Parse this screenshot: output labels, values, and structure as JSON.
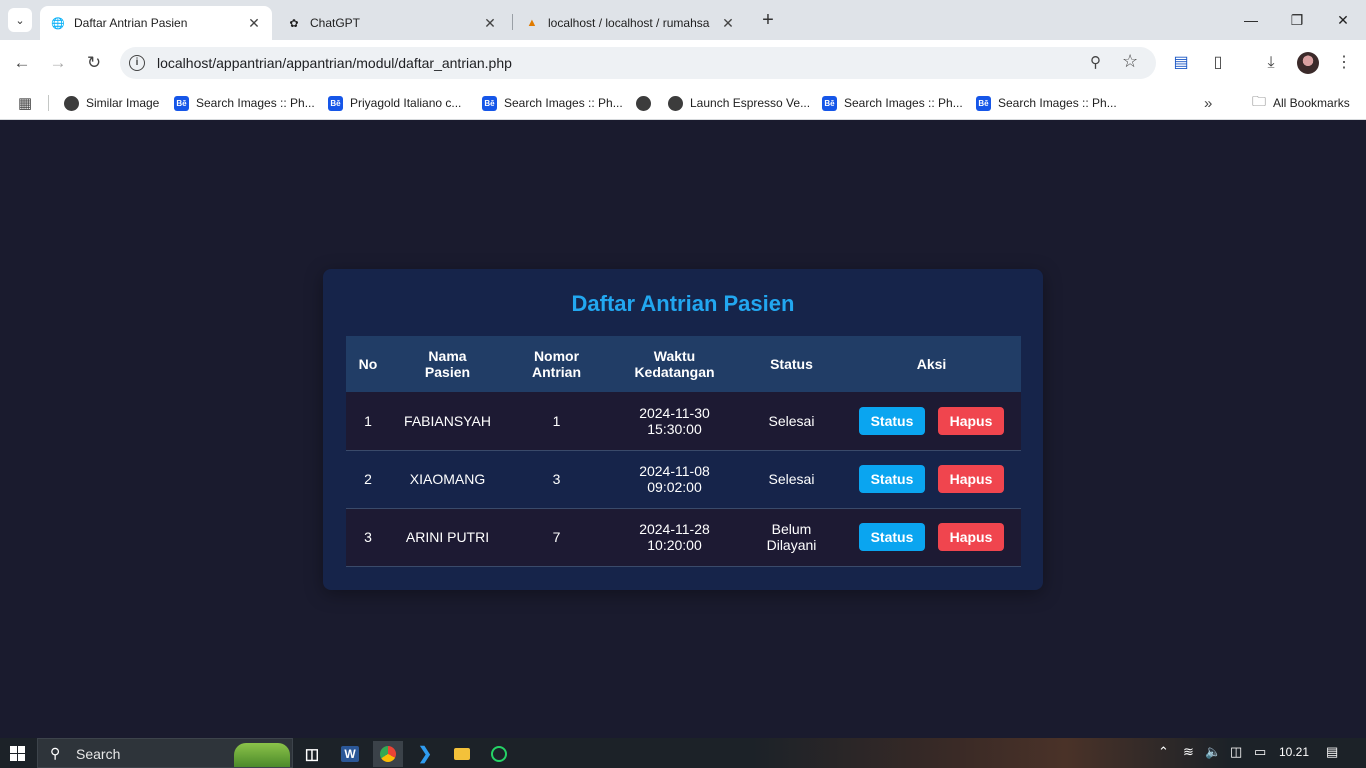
{
  "browser": {
    "tabs": [
      {
        "title": "Daftar Antrian Pasien",
        "active": true
      },
      {
        "title": "ChatGPT",
        "active": false
      },
      {
        "title": "localhost / localhost / rumahsa",
        "active": false
      }
    ],
    "url": "localhost/appantrian/appantrian/modul/daftar_antrian.php",
    "bookmarks": [
      {
        "label": "Similar Image",
        "icon": "globe"
      },
      {
        "label": "Search Images :: Ph...",
        "icon": "behance"
      },
      {
        "label": "Priyagold Italiano c...",
        "icon": "behance"
      },
      {
        "label": "Search Images :: Ph...",
        "icon": "behance"
      },
      {
        "label": "",
        "icon": "globe"
      },
      {
        "label": "Launch Espresso Ve...",
        "icon": "globe"
      },
      {
        "label": "Search Images :: Ph...",
        "icon": "behance"
      },
      {
        "label": "Search Images :: Ph...",
        "icon": "behance"
      }
    ],
    "all_bookmarks": "All Bookmarks"
  },
  "page": {
    "title": "Daftar Antrian Pasien",
    "columns": [
      {
        "line1": "No",
        "line2": ""
      },
      {
        "line1": "Nama",
        "line2": "Pasien"
      },
      {
        "line1": "Nomor",
        "line2": "Antrian"
      },
      {
        "line1": "Waktu",
        "line2": "Kedatangan"
      },
      {
        "line1": "Status",
        "line2": ""
      },
      {
        "line1": "Aksi",
        "line2": ""
      }
    ],
    "rows": [
      {
        "no": "1",
        "nama": "FABIANSYAH",
        "nomor": "1",
        "tanggal": "2024-11-30",
        "jam": "15:30:00",
        "status1": "Selesai",
        "status2": ""
      },
      {
        "no": "2",
        "nama": "XIAOMANG",
        "nomor": "3",
        "tanggal": "2024-11-08",
        "jam": "09:02:00",
        "status1": "Selesai",
        "status2": ""
      },
      {
        "no": "3",
        "nama": "ARINI PUTRI",
        "nomor": "7",
        "tanggal": "2024-11-28",
        "jam": "10:20:00",
        "status1": "Belum",
        "status2": "Dilayani"
      }
    ],
    "btn_status": "Status",
    "btn_hapus": "Hapus",
    "colors": {
      "title": "#22a7f0",
      "status_btn": "#0aa5f0",
      "hapus_btn": "#f0454e",
      "background": "#1a1b2e",
      "card": "#16244a"
    }
  },
  "taskbar": {
    "search_placeholder": "Search",
    "time": "10.21"
  }
}
